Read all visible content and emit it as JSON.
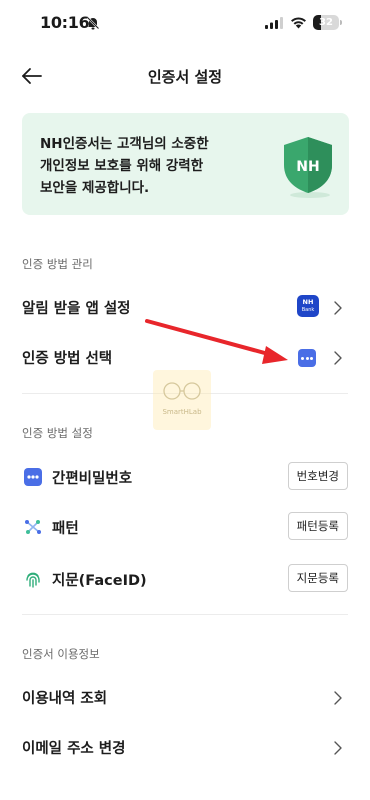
{
  "status_bar": {
    "time": "10:16",
    "battery": "32"
  },
  "header": {
    "title": "인증서 설정"
  },
  "banner": {
    "line1": "NH인증서는 고객님의 소중한",
    "line2": "개인정보 보호를 위해 강력한",
    "line3": "보안을 제공합니다.",
    "shield_text": "NH"
  },
  "section_manage": {
    "label": "인증 방법 관리",
    "items": [
      {
        "label": "알림 받을 앱 설정",
        "icon": "nh-bank-app-icon",
        "icon_text_top": "NH",
        "icon_text_bottom": "Bank"
      },
      {
        "label": "인증 방법 선택",
        "icon": "dots-icon"
      }
    ]
  },
  "section_methods": {
    "label": "인증 방법 설정",
    "items": [
      {
        "label": "간편비밀번호",
        "icon": "dots-icon",
        "button": "번호변경"
      },
      {
        "label": "패턴",
        "icon": "pattern-icon",
        "button": "패턴등록"
      },
      {
        "label": "지문(FaceID)",
        "icon": "fingerprint-icon",
        "button": "지문등록"
      }
    ]
  },
  "section_usage": {
    "label": "인증서 이용정보",
    "items": [
      {
        "label": "이용내역 조회"
      },
      {
        "label": "이메일 주소 변경"
      }
    ]
  },
  "watermark": {
    "text": "SmartHLab"
  },
  "colors": {
    "banner_bg": "#e7f6ed",
    "shield_green": "#3aa76d",
    "accent_blue": "#4a6ee6",
    "nh_bank_blue": "#1f46c8",
    "arrow_red": "#e8262b"
  }
}
